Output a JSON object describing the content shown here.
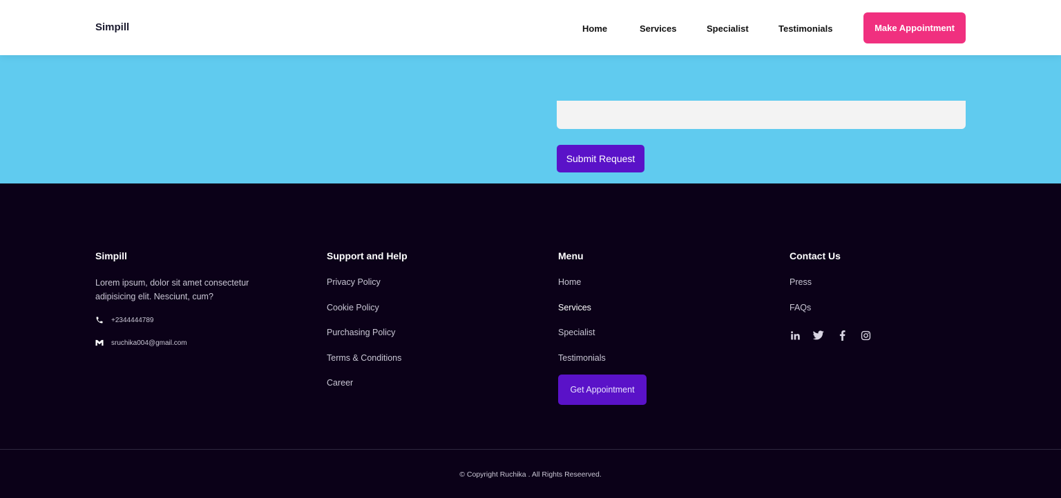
{
  "header": {
    "brand": "Simpill",
    "nav": [
      "Home",
      "Services",
      "Specialist",
      "Testimonials"
    ],
    "cta_label": "Make Appointment"
  },
  "form": {
    "submit_label": "Submit Request"
  },
  "footer": {
    "about": {
      "title": "Simpill",
      "description": "Lorem ipsum, dolor sit amet consectetur adipisicing elit. Nesciunt, cum?",
      "phone": "+2344444789",
      "email": "sruchika004@gmail.com"
    },
    "support": {
      "title": "Support and Help",
      "links": [
        "Privacy Policy",
        "Cookie Policy",
        "Purchasing Policy",
        "Terms & Conditions",
        "Career"
      ]
    },
    "menu": {
      "title": "Menu",
      "links": [
        "Home",
        "Services",
        "Specialist",
        "Testimonials"
      ],
      "button_label": "Get Appointment"
    },
    "contact": {
      "title": "Contact Us",
      "links": [
        "Press",
        "FAQs"
      ],
      "socials": [
        "linkedin-icon",
        "twitter-icon",
        "facebook-icon",
        "instagram-icon"
      ]
    },
    "copyright": "© Copyright Ruchika . All Rights Reseerved."
  },
  "colors": {
    "accent_pink": "#f0307f",
    "accent_purple": "#5a12c8",
    "band_blue": "#60cbef",
    "footer_bg": "#0b0118"
  }
}
